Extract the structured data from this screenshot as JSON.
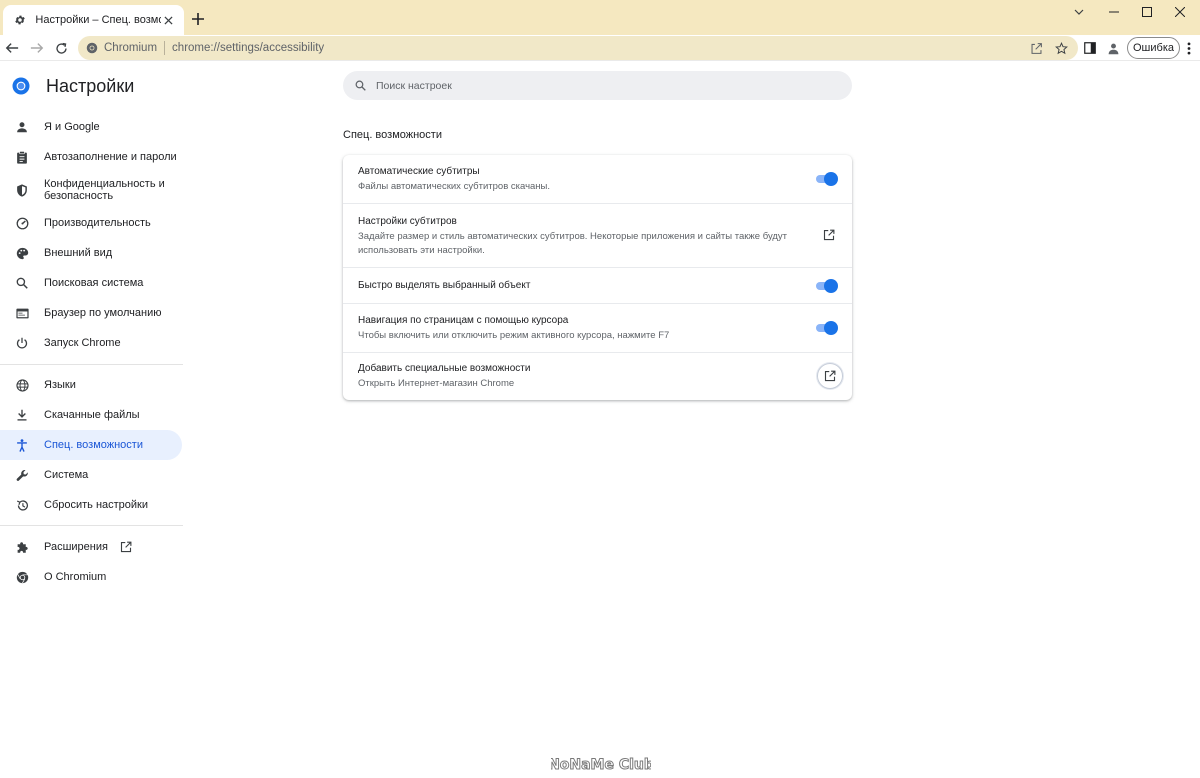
{
  "browser": {
    "tab_title": "Настройки – Спец. возможност",
    "site_chip": "Chromium",
    "url": "chrome://settings/accessibility",
    "error_button": "Ошибка"
  },
  "sidebar": {
    "title": "Настройки",
    "items": [
      {
        "label": "Я и Google",
        "icon": "person-icon"
      },
      {
        "label": "Автозаполнение и пароли",
        "icon": "clipboard-icon"
      },
      {
        "label": "Конфиденциальность и безопасность",
        "icon": "shield-icon"
      },
      {
        "label": "Производительность",
        "icon": "speedometer-icon"
      },
      {
        "label": "Внешний вид",
        "icon": "palette-icon"
      },
      {
        "label": "Поисковая система",
        "icon": "search-icon"
      },
      {
        "label": "Браузер по умолчанию",
        "icon": "browser-icon"
      },
      {
        "label": "Запуск Chrome",
        "icon": "power-icon"
      },
      {
        "label": "Языки",
        "icon": "globe-icon"
      },
      {
        "label": "Скачанные файлы",
        "icon": "download-icon"
      },
      {
        "label": "Спец. возможности",
        "icon": "accessibility-icon",
        "active": true
      },
      {
        "label": "Система",
        "icon": "wrench-icon"
      },
      {
        "label": "Сбросить настройки",
        "icon": "restore-icon"
      },
      {
        "label": "Расширения",
        "icon": "puzzle-icon"
      },
      {
        "label": "О Chromium",
        "icon": "chromium-icon"
      }
    ]
  },
  "search": {
    "placeholder": "Поиск настроек"
  },
  "section": {
    "title": "Спец. возможности",
    "rows": [
      {
        "title": "Автоматические субтитры",
        "subtitle": "Файлы автоматических субтитров скачаны.",
        "control": "toggle",
        "on": true
      },
      {
        "title": "Настройки субтитров",
        "subtitle": "Задайте размер и стиль автоматических субтитров. Некоторые приложения и сайты также будут использовать эти настройки.",
        "control": "external-link"
      },
      {
        "title": "Быстро выделять выбранный объект",
        "subtitle": "",
        "control": "toggle",
        "on": true
      },
      {
        "title": "Навигация по страницам с помощью курсора",
        "subtitle": "Чтобы включить или отключить режим активного курсора, нажмите F7",
        "control": "toggle",
        "on": true
      },
      {
        "title": "Добавить специальные возможности",
        "subtitle": "Открыть Интернет-магазин Chrome",
        "control": "external-link"
      }
    ]
  },
  "watermark": "NoNaMe Club",
  "colors": {
    "accent": "#1a73e8",
    "active_nav_bg": "#e8f0fe",
    "titlebar": "#f5e8c0"
  }
}
